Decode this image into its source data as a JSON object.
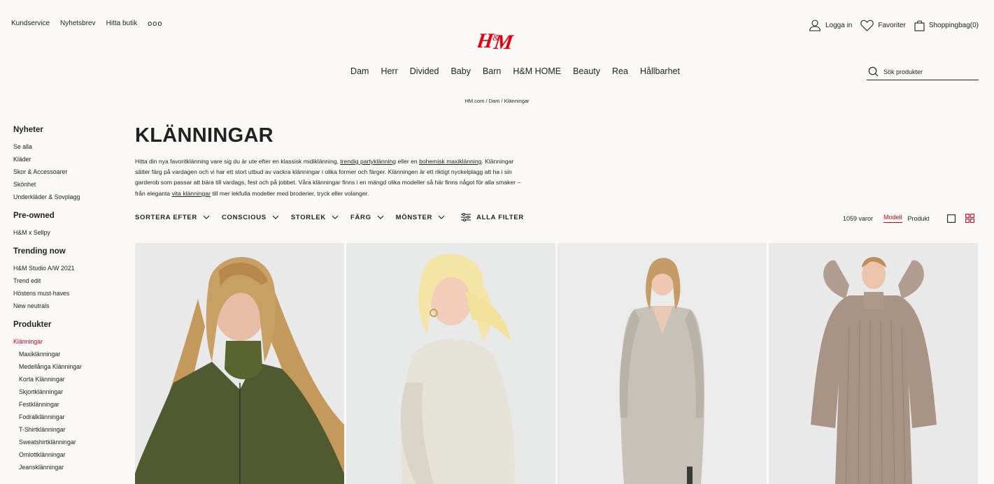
{
  "utility_links": [
    "Kundservice",
    "Nyhetsbrev",
    "Hitta butik"
  ],
  "utility_more": "ooo",
  "account": {
    "login": "Logga in",
    "favorites": "Favoriter",
    "bag": "Shoppingbag(0)"
  },
  "main_nav": [
    "Dam",
    "Herr",
    "Divided",
    "Baby",
    "Barn",
    "H&M HOME",
    "Beauty",
    "Rea",
    "Hållbarhet"
  ],
  "search": {
    "placeholder": "Sök produkter"
  },
  "breadcrumb": "HM.com / Dam / Klänningar",
  "sidebar": [
    {
      "heading": "Nyheter",
      "items": [
        {
          "label": "Se alla"
        },
        {
          "label": "Kläder"
        },
        {
          "label": "Skor & Accessoarer"
        },
        {
          "label": "Skönhet"
        },
        {
          "label": "Underkläder & Sovplagg"
        }
      ]
    },
    {
      "heading": "Pre-owned",
      "items": [
        {
          "label": "H&M x Sellpy"
        }
      ]
    },
    {
      "heading": "Trending now",
      "items": [
        {
          "label": "H&M Studio A/W 2021"
        },
        {
          "label": "Trend edit"
        },
        {
          "label": "Höstens must-haves"
        },
        {
          "label": "New neutrals"
        }
      ]
    },
    {
      "heading": "Produkter",
      "items": [
        {
          "label": "Klänningar",
          "active": true
        },
        {
          "label": "Maxiklänningar",
          "sub": true
        },
        {
          "label": "Medellånga Klänningar",
          "sub": true
        },
        {
          "label": "Korta Klänningar",
          "sub": true
        },
        {
          "label": "Skjortklänningar",
          "sub": true
        },
        {
          "label": "Festklänningar",
          "sub": true
        },
        {
          "label": "Fodralklänningar",
          "sub": true
        },
        {
          "label": "T-Shirtklänningar",
          "sub": true
        },
        {
          "label": "Sweatshirtklänningar",
          "sub": true
        },
        {
          "label": "Omlottklänningar",
          "sub": true
        },
        {
          "label": "Jeansklänningar",
          "sub": true
        }
      ]
    }
  ],
  "page_title": "KLÄNNINGAR",
  "intro": {
    "p1": "Hitta din nya favoritklänning vare sig du är ute efter en klassisk midiklänning, ",
    "link1": "trendig partyklänning",
    "p2": " eller en ",
    "link2": "bohemisk maxiklänning",
    "p3": ". Klänningar sätter färg på vardagen och vi har ett stort utbud av vackra klänningar i olika former och färger. Klänningen är ett riktigt nyckelplagg att ha i sin garderob som passar att bära till vardags, fest och på jobbet. Våra klänningar finns i en mängd olika modeller så här finns något för alla smaker – från eleganta ",
    "link3": "vita klänningar",
    "p4": " till mer lekfulla modeller med broderier, tryck eller volanger."
  },
  "filters": [
    "SORTERA EFTER",
    "CONSCIOUS",
    "STORLEK",
    "FÄRG",
    "MÖNSTER"
  ],
  "all_filters": "ALLA FILTER",
  "result_count": "1059 varor",
  "view_toggle": {
    "model": "Modell",
    "product": "Produkt"
  },
  "colors": {
    "brand_red": "#e50010",
    "active_red": "#cc071e",
    "background": "#faf9f8"
  },
  "products": [
    {
      "image": "woman-green-ribbed-turtleneck-dress"
    },
    {
      "image": "woman-cream-knit-sweater-dress"
    },
    {
      "image": "woman-grey-v-neck-knit-dress"
    },
    {
      "image": "woman-beige-ribbed-maxi-knit-dress"
    }
  ]
}
